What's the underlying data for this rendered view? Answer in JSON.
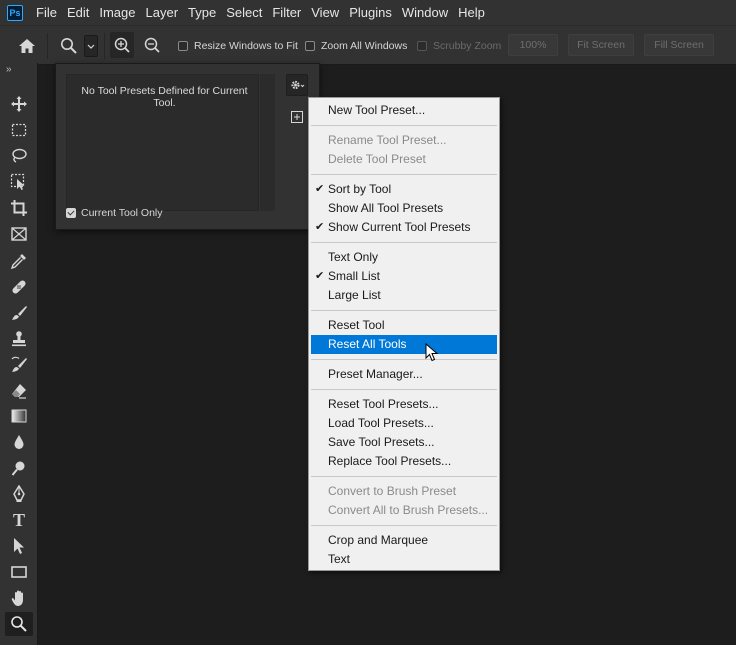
{
  "app": {
    "logo_text": "Ps"
  },
  "menubar": {
    "items": [
      "File",
      "Edit",
      "Image",
      "Layer",
      "Type",
      "Select",
      "Filter",
      "View",
      "Plugins",
      "Window",
      "Help"
    ]
  },
  "options_bar": {
    "resize_windows_to_fit": "Resize Windows to Fit",
    "zoom_all_windows": "Zoom All Windows",
    "scrubby_zoom": "Scrubby Zoom",
    "zoom_percent": "100%",
    "fit_screen": "Fit Screen",
    "fill_screen": "Fill Screen"
  },
  "toolbar": {
    "collapse_label": "»",
    "tools": [
      {
        "name": "move-tool",
        "icon": "move-icon"
      },
      {
        "name": "marquee-tool",
        "icon": "marquee-icon"
      },
      {
        "name": "lasso-tool",
        "icon": "lasso-icon"
      },
      {
        "name": "object-selection-tool",
        "icon": "object-selection-icon"
      },
      {
        "name": "crop-tool",
        "icon": "crop-icon"
      },
      {
        "name": "frame-tool",
        "icon": "frame-icon"
      },
      {
        "name": "eyedropper-tool",
        "icon": "eyedropper-icon"
      },
      {
        "name": "healing-brush-tool",
        "icon": "bandage-icon"
      },
      {
        "name": "brush-tool",
        "icon": "brush-icon"
      },
      {
        "name": "clone-stamp-tool",
        "icon": "stamp-icon"
      },
      {
        "name": "history-brush-tool",
        "icon": "history-brush-icon"
      },
      {
        "name": "eraser-tool",
        "icon": "eraser-icon"
      },
      {
        "name": "gradient-tool",
        "icon": "gradient-icon"
      },
      {
        "name": "blur-tool",
        "icon": "drop-icon"
      },
      {
        "name": "dodge-tool",
        "icon": "dodge-icon"
      },
      {
        "name": "pen-tool",
        "icon": "pen-icon"
      },
      {
        "name": "type-tool",
        "icon": "type-icon",
        "label": "T"
      },
      {
        "name": "path-selection-tool",
        "icon": "arrow-icon"
      },
      {
        "name": "rectangle-tool",
        "icon": "rectangle-icon"
      },
      {
        "name": "hand-tool",
        "icon": "hand-icon"
      },
      {
        "name": "zoom-tool",
        "icon": "zoom-icon"
      }
    ]
  },
  "preset_panel": {
    "empty_message": "No Tool Presets Defined for Current Tool.",
    "current_tool_only": "Current Tool Only"
  },
  "context_menu": {
    "new_tool_preset": "New Tool Preset...",
    "rename_tool_preset": "Rename Tool Preset...",
    "delete_tool_preset": "Delete Tool Preset",
    "sort_by_tool": "Sort by Tool",
    "show_all_tool_presets": "Show All Tool Presets",
    "show_current_tool_presets": "Show Current Tool Presets",
    "text_only": "Text Only",
    "small_list": "Small List",
    "large_list": "Large List",
    "reset_tool": "Reset Tool",
    "reset_all_tools": "Reset All Tools",
    "preset_manager": "Preset Manager...",
    "reset_tool_presets": "Reset Tool Presets...",
    "load_tool_presets": "Load Tool Presets...",
    "save_tool_presets": "Save Tool Presets...",
    "replace_tool_presets": "Replace Tool Presets...",
    "convert_to_brush_preset": "Convert to Brush Preset",
    "convert_all_to_brush_presets": "Convert All to Brush Presets...",
    "crop_and_marquee": "Crop and Marquee",
    "text": "Text",
    "check_glyph": "✔"
  }
}
